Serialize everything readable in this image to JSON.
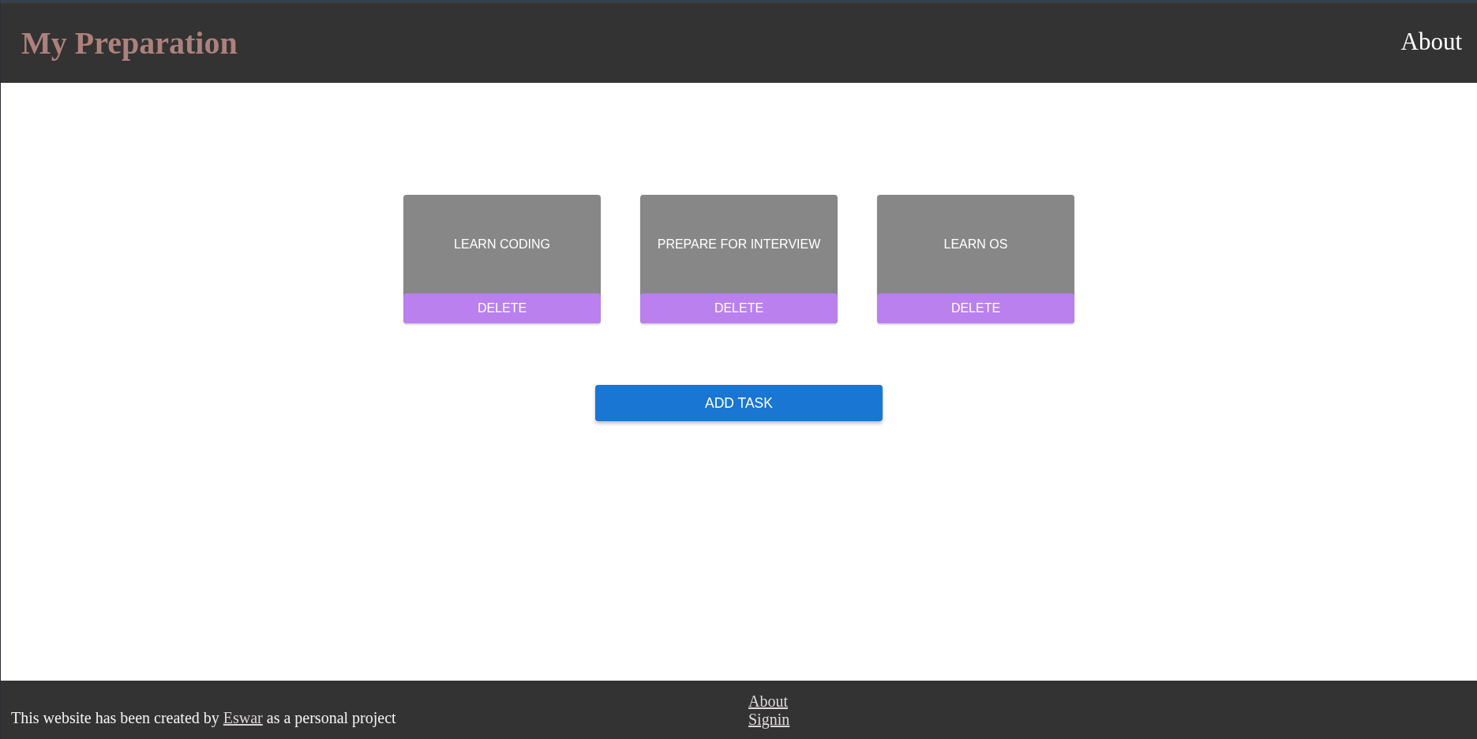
{
  "header": {
    "title": "My Preparation",
    "nav_link": "About"
  },
  "tasks": [
    {
      "title": "LEARN CODING",
      "action": "DELETE"
    },
    {
      "title": "PREPARE FOR INTERVIEW",
      "action": "DELETE"
    },
    {
      "title": "LEARN OS",
      "action": "DELETE"
    }
  ],
  "add_button": "ADD TASK",
  "footer": {
    "credit_before": "This website has been created by",
    "author_link": "Eswar",
    "credit_after": "as a personal project",
    "links": [
      "About",
      "Signin"
    ]
  }
}
